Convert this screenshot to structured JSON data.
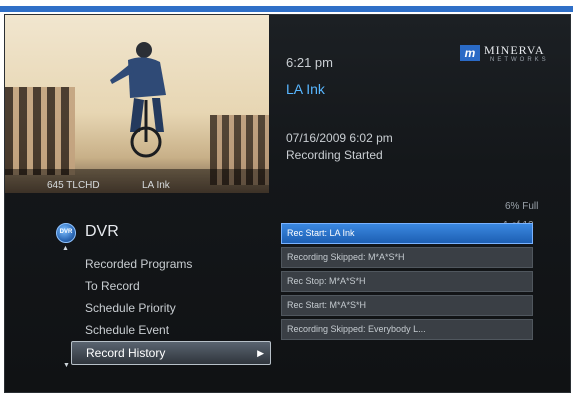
{
  "video": {
    "channel": "645 TLCHD",
    "program": "LA Ink"
  },
  "info": {
    "time": "6:21 pm",
    "title": "LA Ink",
    "date": "07/16/2009 6:02 pm",
    "status": "Recording Started"
  },
  "logo": {
    "badge": "m",
    "word": "MINERVA",
    "sub": "NETWORKS"
  },
  "capacity": "6% Full",
  "pagination": "1 of 12",
  "menu": {
    "title": "DVR",
    "icon_label": "DVR",
    "items": [
      {
        "label": "Recorded Programs"
      },
      {
        "label": "To Record"
      },
      {
        "label": "Schedule Priority"
      },
      {
        "label": "Schedule Event"
      },
      {
        "label": "Record History",
        "selected": true
      }
    ]
  },
  "history": [
    {
      "label": "Rec Start: LA Ink"
    },
    {
      "label": "Recording Skipped: M*A*S*H"
    },
    {
      "label": "Rec Stop: M*A*S*H"
    },
    {
      "label": "Rec Start: M*A*S*H"
    },
    {
      "label": "Recording Skipped: Everybody L..."
    }
  ],
  "colors": {
    "accent": "#58b6ff",
    "selection": "#2f6fc7",
    "brand": "#2a6ac6"
  }
}
